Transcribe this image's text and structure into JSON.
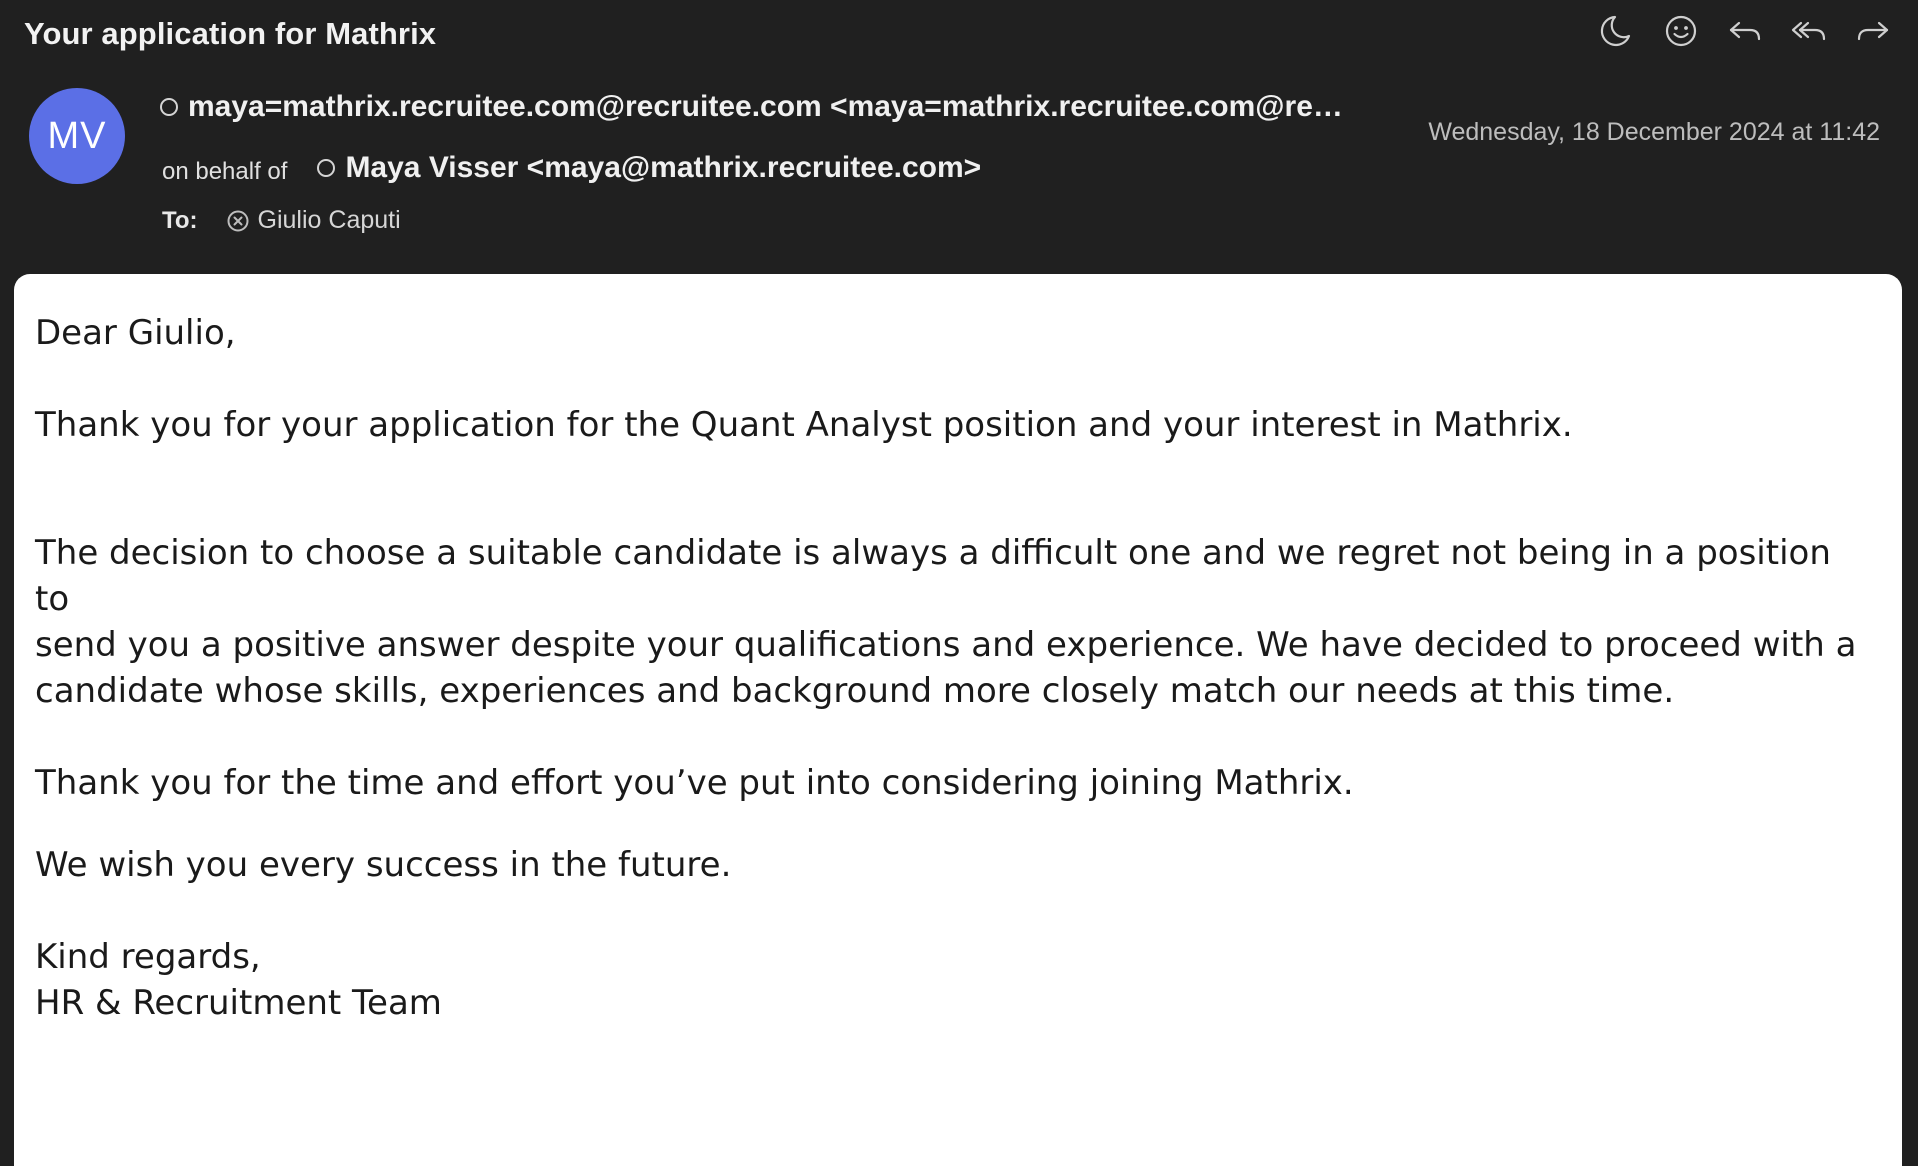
{
  "email": {
    "subject": "Your application for Mathrix",
    "avatar_initials": "MV",
    "avatar_color": "#5b6fe6",
    "sender": "maya=mathrix.recruitee.com@recruitee.com <maya=mathrix.recruitee.com@recr...",
    "behalf_label": "on behalf of",
    "behalf_name": "Maya Visser <maya@mathrix.recruitee.com>",
    "date": "Wednesday, 18 December 2024 at 11:42",
    "to_label": "To:",
    "recipient": "Giulio Caputi",
    "body": {
      "greeting": "Dear Giulio,",
      "para1": "Thank you for your application for the Quant Analyst position and your interest in Mathrix.",
      "para2_line1": "The decision to choose a suitable candidate is always a difficult one and we regret not being in a position to",
      "para2_line2": "send you a positive answer despite your qualifications and experience. We have decided to proceed with a",
      "para2_line3": "candidate whose skills, experiences and background more closely match our needs at this time.",
      "para3": "Thank you for the time and effort you’ve put into considering joining Mathrix.",
      "para4": "We wish you every success in the future.",
      "closing": "Kind regards,",
      "signature": "HR & Recruitment Team"
    }
  },
  "toolbar": {
    "icons": [
      "moon-icon",
      "smiley-icon",
      "reply-icon",
      "reply-all-icon",
      "forward-icon"
    ]
  }
}
